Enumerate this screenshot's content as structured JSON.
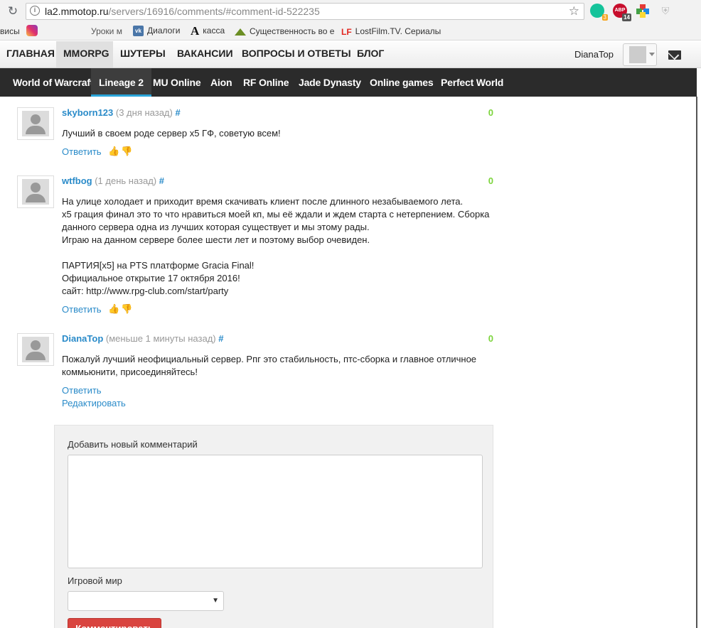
{
  "browser": {
    "url_host": "la2.mmotop.ru",
    "url_path": "/servers/16916/comments/#comment-id-522235",
    "ext_grammarly_badge": "3",
    "ext_abp_label": "ABP",
    "ext_abp_badge": "14"
  },
  "bookmarks": [
    {
      "label": "висы"
    },
    {
      "label": ""
    },
    {
      "label": "Уроки м"
    },
    {
      "label": "Диалоги"
    },
    {
      "label": "касса"
    },
    {
      "label": "Существенность во е"
    },
    {
      "label": "LostFilm.TV. Сериалы"
    }
  ],
  "site_nav": {
    "items": [
      "ГЛАВНАЯ",
      "MMORPG",
      "ШУТЕРЫ",
      "ВАКАНСИИ",
      "ВОПРОСЫ И ОТВЕТЫ",
      "БЛОГ"
    ],
    "active": "MMORPG",
    "username": "DianaTop"
  },
  "games": [
    "World of Warcraft",
    "Lineage 2",
    "MU Online",
    "Aion",
    "RF Online",
    "Jade Dynasty",
    "Online games",
    "Perfect World"
  ],
  "comments": [
    {
      "author": "skyborn123",
      "time": "(3 дня назад)",
      "hash": "#",
      "score": "0",
      "text": "Лучший в своем роде сервер х5 ГФ, советую всем!",
      "reply": "Ответить"
    },
    {
      "author": "wtfbog",
      "time": "(1 день назад)",
      "hash": "#",
      "score": "0",
      "text": "На улице холодает и приходит время скачивать клиент после длинного незабываемого лета.\nx5 грация финал это то что нравиться моей кп, мы её ждали и ждем старта с нетерпением. Сборка данного сервера одна из лучших которая существует и мы этому рады.\nИграю на данном сервере более шести лет и поэтому выбор очевиден.\n\nПАРТИЯ[x5] на PTS платформе Gracia Final!\nОфициальное открытие 17 октября 2016!\nсайт: http://www.rpg-club.com/start/party",
      "reply": "Ответить"
    },
    {
      "author": "DianaTop",
      "time": "(меньше 1 минуты назад)",
      "hash": "#",
      "score": "0",
      "text": "Пожалуй лучший неофициальный сервер. Рпг это стабильность, птс-сборка и главное отличное коммьюнити, присоединяйтесь!",
      "reply": "Ответить",
      "edit": "Редактировать"
    }
  ],
  "form": {
    "title": "Добавить новый комментарий",
    "textarea_value": "",
    "world_label": "Игровой мир",
    "world_value": "",
    "submit": "Комментировать"
  },
  "colors": {
    "link": "#2a8bc9",
    "score": "#7cd43c",
    "submit": "#d9443f",
    "game_bar": "#2b2b2b"
  }
}
